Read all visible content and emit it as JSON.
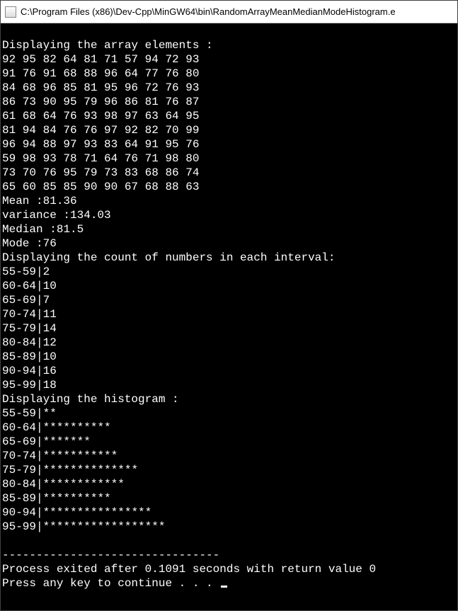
{
  "window": {
    "title_path": "C:\\Program Files (x86)\\Dev-Cpp\\MinGW64\\bin\\RandomArrayMeanMedianModeHistogram.e"
  },
  "header_array": "Displaying the array elements :",
  "array_rows": [
    "92 95 82 64 81 71 57 94 72 93",
    "91 76 91 68 88 96 64 77 76 80",
    "84 68 96 85 81 95 96 72 76 93",
    "86 73 90 95 79 96 86 81 76 87",
    "61 68 64 76 93 98 97 63 64 95",
    "81 94 84 76 76 97 92 82 70 99",
    "96 94 88 97 93 83 64 91 95 76",
    "59 98 93 78 71 64 76 71 98 80",
    "73 70 76 95 79 73 83 68 86 74",
    "65 60 85 85 90 90 67 68 88 63"
  ],
  "stats": {
    "mean_label": "Mean :",
    "mean_value": "81.36",
    "variance_label": "variance :",
    "variance_value": "134.03",
    "median_label": "Median :",
    "median_value": "81.5",
    "mode_label": "Mode :",
    "mode_value": "76"
  },
  "header_counts": "Displaying the count of numbers in each interval:",
  "counts": [
    {
      "range": "55-59",
      "count": "2"
    },
    {
      "range": "60-64",
      "count": "10"
    },
    {
      "range": "65-69",
      "count": "7"
    },
    {
      "range": "70-74",
      "count": "11"
    },
    {
      "range": "75-79",
      "count": "14"
    },
    {
      "range": "80-84",
      "count": "12"
    },
    {
      "range": "85-89",
      "count": "10"
    },
    {
      "range": "90-94",
      "count": "16"
    },
    {
      "range": "95-99",
      "count": "18"
    }
  ],
  "header_histogram": "Displaying the histogram :",
  "histogram": [
    {
      "range": "55-59",
      "bars": "**"
    },
    {
      "range": "60-64",
      "bars": "**********"
    },
    {
      "range": "65-69",
      "bars": "*******"
    },
    {
      "range": "70-74",
      "bars": "***********"
    },
    {
      "range": "75-79",
      "bars": "**************"
    },
    {
      "range": "80-84",
      "bars": "************"
    },
    {
      "range": "85-89",
      "bars": "**********"
    },
    {
      "range": "90-94",
      "bars": "****************"
    },
    {
      "range": "95-99",
      "bars": "******************"
    }
  ],
  "divider": "--------------------------------",
  "exit_line": "Process exited after 0.1091 seconds with return value 0",
  "continue_prompt": "Press any key to continue . . . ",
  "chart_data": {
    "type": "bar",
    "title": "Displaying the histogram :",
    "categories": [
      "55-59",
      "60-64",
      "65-69",
      "70-74",
      "75-79",
      "80-84",
      "85-89",
      "90-94",
      "95-99"
    ],
    "values": [
      2,
      10,
      7,
      11,
      14,
      12,
      10,
      16,
      18
    ],
    "xlabel": "interval",
    "ylabel": "count",
    "ylim": [
      0,
      18
    ]
  }
}
